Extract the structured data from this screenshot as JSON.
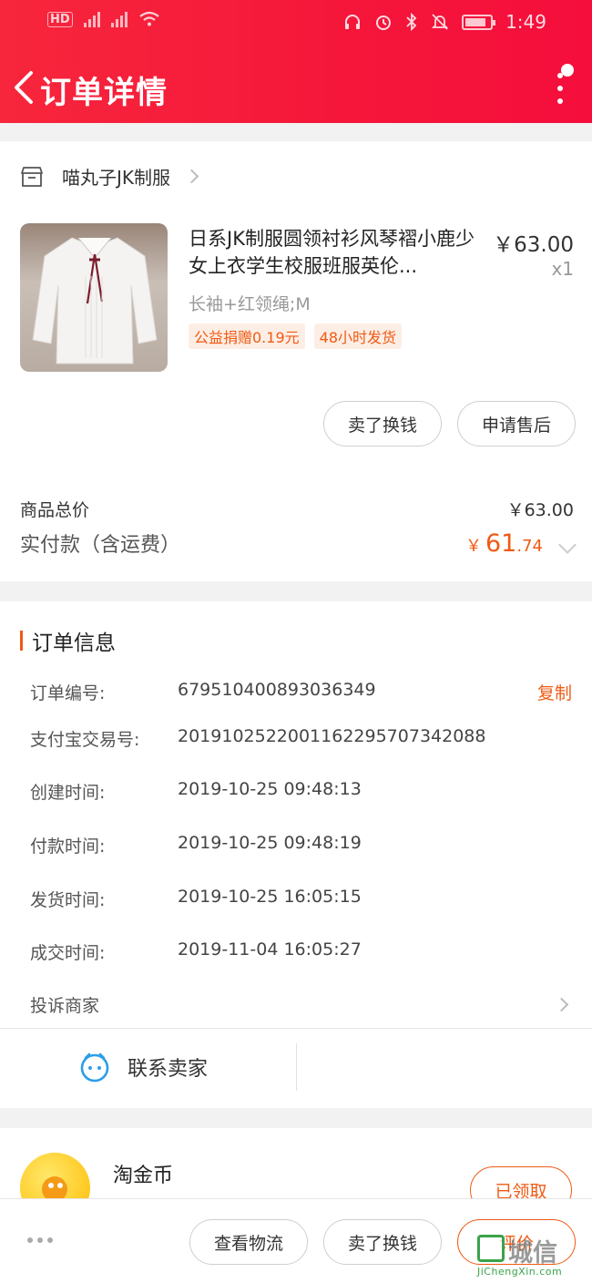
{
  "status_bar": {
    "time": "1:49",
    "hd": "HD",
    "net1": "4G",
    "net2": "4G"
  },
  "header": {
    "title": "订单详情"
  },
  "shop": {
    "name": "喵丸子JK制服"
  },
  "product": {
    "title": "日系JK制服圆领衬衫风琴褶小鹿少女上衣学生校服班服英伦...",
    "price": "￥63.00",
    "qty": "x1",
    "sku": "长袖+红领绳;M",
    "tags": [
      "公益捐赠0.19元",
      "48小时发货"
    ]
  },
  "product_actions": {
    "sell_label": "卖了换钱",
    "aftersale_label": "申请售后"
  },
  "summary": {
    "goods_total_label": "商品总价",
    "goods_total_value": "￥63.00",
    "paid_label": "实付款（含运费）",
    "paid_currency": "￥",
    "paid_int": "61",
    "paid_dec": ".74"
  },
  "order_info": {
    "title": "订单信息",
    "copy_label": "复制",
    "rows": [
      {
        "label": "订单编号:",
        "value": "679510400893036349"
      },
      {
        "label": "支付宝交易号:",
        "value": "2019102522001162295707342088"
      },
      {
        "label": "创建时间:",
        "value": "2019-10-25 09:48:13"
      },
      {
        "label": "付款时间:",
        "value": "2019-10-25 09:48:19"
      },
      {
        "label": "发货时间:",
        "value": "2019-10-25 16:05:15"
      },
      {
        "label": "成交时间:",
        "value": "2019-11-04 16:05:27"
      }
    ],
    "complain_label": "投诉商家",
    "contact_label": "联系卖家"
  },
  "coins": {
    "title": "淘金币",
    "claimed_label": "已领取"
  },
  "bottom_bar": {
    "logistics_label": "查看物流",
    "sell_label": "卖了换钱",
    "review_label": "评价"
  },
  "watermark": {
    "text": "城信",
    "url": "JiChengXin.com"
  },
  "colors": {
    "accent": "#f05a14",
    "header": "#f5163a"
  }
}
